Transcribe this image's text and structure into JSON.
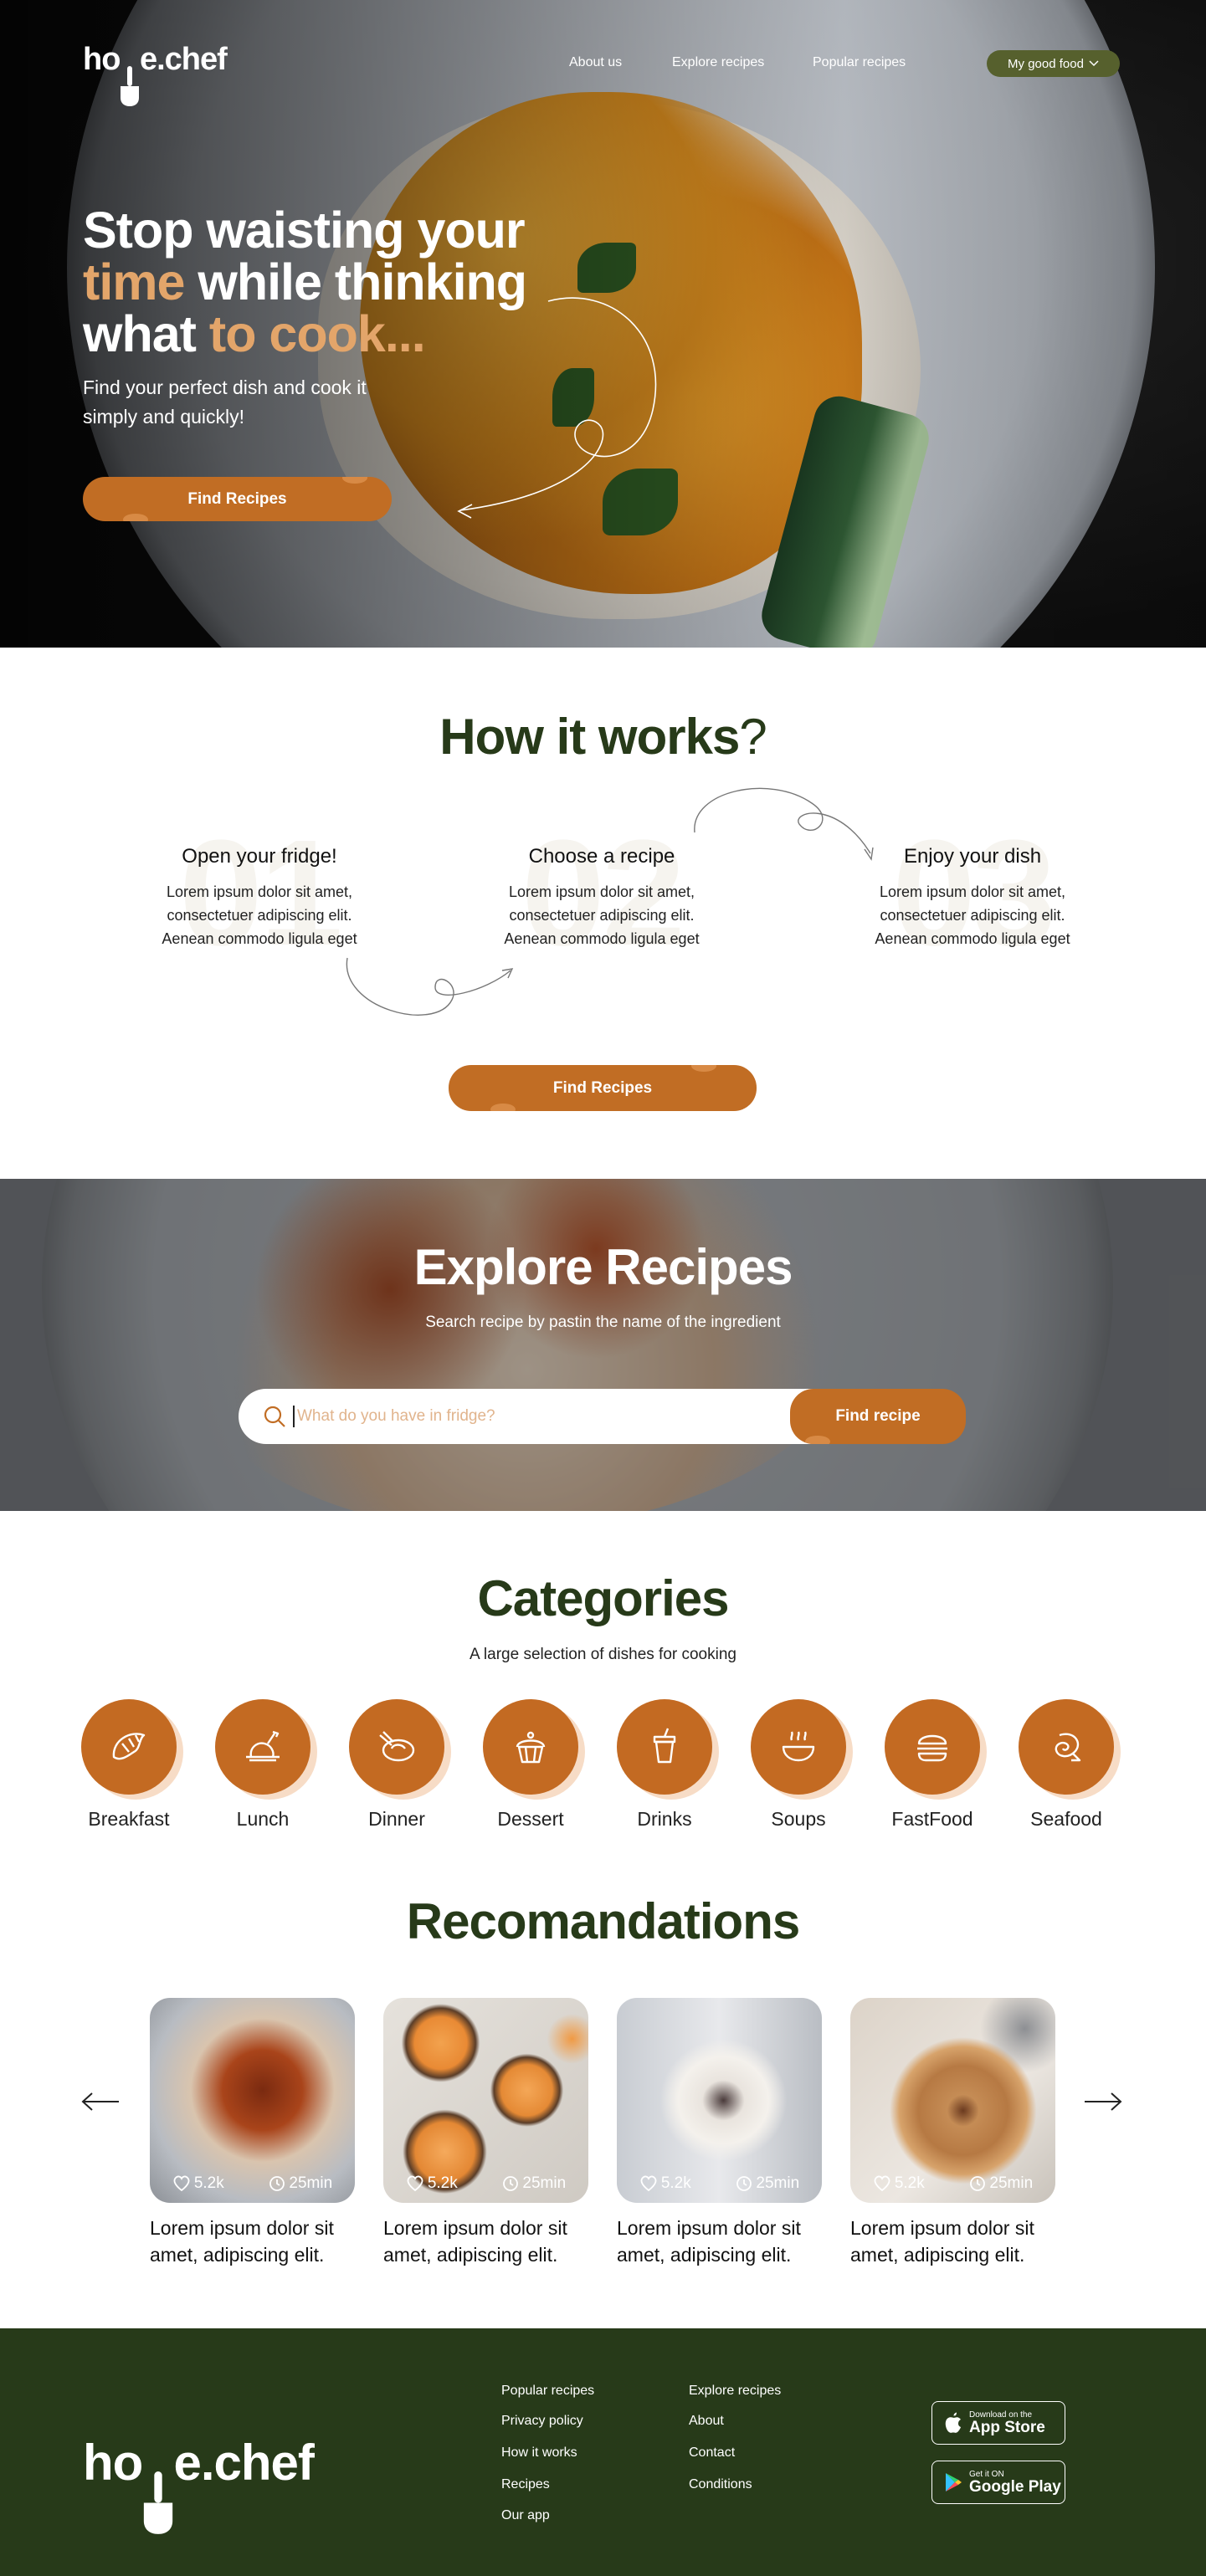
{
  "brand": {
    "logo_left": "ho",
    "logo_right": "e.chef"
  },
  "nav": {
    "links": [
      "About us",
      "Explore recipes",
      "Popular recipes"
    ],
    "account_label": "My good food"
  },
  "hero": {
    "line1": "Stop waisting your",
    "line2_accent": "time",
    "line2_rest": " while thinking",
    "line3_start": "what ",
    "line3_accent": "to cook",
    "line3_dots": "...",
    "subtitle": "Find your perfect dish and cook it simply and quickly!",
    "cta": "Find Recipes"
  },
  "how_it_works": {
    "title": "How it works",
    "title_mark": "?",
    "steps": [
      {
        "number": "01",
        "title": "Open your fridge!",
        "text": "Lorem ipsum dolor sit amet, consectetuer adipiscing elit. Aenean commodo ligula eget"
      },
      {
        "number": "02",
        "title": "Choose a recipe",
        "text": "Lorem ipsum dolor sit amet, consectetuer adipiscing elit. Aenean commodo ligula eget"
      },
      {
        "number": "03",
        "title": "Enjoy your dish",
        "text": "Lorem ipsum dolor sit amet, consectetuer adipiscing elit. Aenean commodo ligula eget"
      }
    ],
    "cta": "Find Recipes"
  },
  "explore": {
    "title": "Explore Recipes",
    "subtitle": "Search recipe by pastin the name of the ingredient",
    "search_placeholder": "What do you have in fridge?",
    "search_value": "",
    "search_button": "Find recipe"
  },
  "categories": {
    "title": "Categories",
    "subtitle": "A large selection of dishes for cooking",
    "items": [
      {
        "label": "Breakfast",
        "icon": "croissant-icon"
      },
      {
        "label": "Lunch",
        "icon": "roast-chicken-icon"
      },
      {
        "label": "Dinner",
        "icon": "dinner-plate-icon"
      },
      {
        "label": "Dessert",
        "icon": "cupcake-icon"
      },
      {
        "label": "Drinks",
        "icon": "drink-cup-icon"
      },
      {
        "label": "Soups",
        "icon": "soup-bowl-icon"
      },
      {
        "label": "FastFood",
        "icon": "burger-icon"
      },
      {
        "label": "Seafood",
        "icon": "shrimp-icon"
      }
    ],
    "accent_color": "#c36a22"
  },
  "recommendations": {
    "title": "Recomandations",
    "cards": [
      {
        "likes": "5.2k",
        "time": "25min",
        "title": "Lorem ipsum dolor sit amet, adipiscing elit."
      },
      {
        "likes": "5.2k",
        "time": "25min",
        "title": "Lorem ipsum dolor sit amet, adipiscing elit."
      },
      {
        "likes": "5.2k",
        "time": "25min",
        "title": "Lorem ipsum dolor sit amet, adipiscing elit."
      },
      {
        "likes": "5.2k",
        "time": "25min",
        "title": "Lorem ipsum dolor sit amet, adipiscing elit."
      }
    ]
  },
  "footer": {
    "col1": [
      "Popular recipes",
      "Privacy policy",
      "How it works",
      "Recipes",
      "Our app"
    ],
    "col2": [
      "Explore recipes",
      "About",
      "Contact",
      "Conditions"
    ],
    "app_store": {
      "small": "Download on the",
      "big": "App Store"
    },
    "google_play": {
      "small": "Get it ON",
      "big": "Google Play"
    }
  },
  "colors": {
    "brand_green": "#273a19",
    "brand_orange": "#c16d24",
    "accent_peach": "#e3a56a",
    "olive_pill": "#56602d"
  }
}
